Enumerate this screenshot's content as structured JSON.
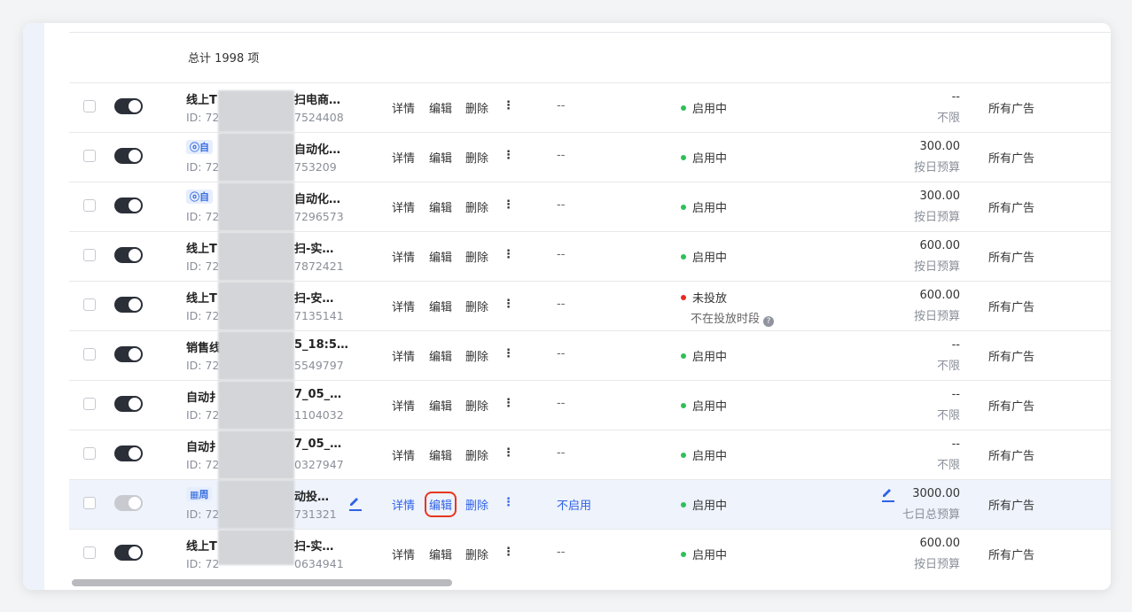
{
  "summary": "总计 1998 项",
  "actions": {
    "detail": "详情",
    "edit": "编辑",
    "delete": "删除",
    "more": "⋮"
  },
  "rows": [
    {
      "name_start": "线上T",
      "name_end": "扫电商…",
      "tag": "",
      "id_prefix": "ID: 72",
      "id_suffix": "7524408",
      "col": "--",
      "status": "启用中",
      "status_color": "#2fbf5a",
      "substatus": "",
      "budget_value": "--",
      "budget_type": "不限",
      "scope": "所有广告",
      "toggle_on": true
    },
    {
      "name_start": "",
      "name_end": "自动化…",
      "tag": "ⓞ自",
      "id_prefix": "ID: 72",
      "id_suffix": "753209",
      "col": "--",
      "status": "启用中",
      "status_color": "#2fbf5a",
      "substatus": "",
      "budget_value": "300.00",
      "budget_type": "按日预算",
      "scope": "所有广告",
      "toggle_on": true
    },
    {
      "name_start": "",
      "name_end": "自动化…",
      "tag": "ⓞ自",
      "id_prefix": "ID: 72",
      "id_suffix": "7296573",
      "col": "--",
      "status": "启用中",
      "status_color": "#2fbf5a",
      "substatus": "",
      "budget_value": "300.00",
      "budget_type": "按日预算",
      "scope": "所有广告",
      "toggle_on": true
    },
    {
      "name_start": "线上T",
      "name_end": "扫-实…",
      "tag": "",
      "id_prefix": "ID: 72",
      "id_suffix": "7872421",
      "col": "--",
      "status": "启用中",
      "status_color": "#2fbf5a",
      "substatus": "",
      "budget_value": "600.00",
      "budget_type": "按日预算",
      "scope": "所有广告",
      "toggle_on": true
    },
    {
      "name_start": "线上T",
      "name_end": "扫-安…",
      "tag": "",
      "id_prefix": "ID: 72",
      "id_suffix": "7135141",
      "col": "--",
      "status": "未投放",
      "status_color": "#e8291f",
      "substatus": "不在投放时段",
      "budget_value": "600.00",
      "budget_type": "按日预算",
      "scope": "所有广告",
      "toggle_on": true
    },
    {
      "name_start": "销售线",
      "name_end": "5_18:5…",
      "tag": "",
      "id_prefix": "ID: 72",
      "id_suffix": "5549797",
      "col": "--",
      "status": "启用中",
      "status_color": "#2fbf5a",
      "substatus": "",
      "budget_value": "--",
      "budget_type": "不限",
      "scope": "所有广告",
      "toggle_on": true
    },
    {
      "name_start": "自动扌",
      "name_end": "7_05_…",
      "tag": "",
      "id_prefix": "ID: 72",
      "id_suffix": "1104032",
      "col": "--",
      "status": "启用中",
      "status_color": "#2fbf5a",
      "substatus": "",
      "budget_value": "--",
      "budget_type": "不限",
      "scope": "所有广告",
      "toggle_on": true
    },
    {
      "name_start": "自动扌",
      "name_end": "7_05_…",
      "tag": "",
      "id_prefix": "ID: 72",
      "id_suffix": "0327947",
      "col": "--",
      "status": "启用中",
      "status_color": "#2fbf5a",
      "substatus": "",
      "budget_value": "--",
      "budget_type": "不限",
      "scope": "所有广告",
      "toggle_on": true
    },
    {
      "name_start": "",
      "name_end": "动投…",
      "tag": "▦周",
      "id_prefix": "ID: 72",
      "id_suffix": "731321",
      "col": "不启用",
      "status": "启用中",
      "status_color": "#2fbf5a",
      "substatus": "",
      "budget_value": "3000.00",
      "budget_type": "七日总预算",
      "scope": "所有广告",
      "toggle_on": false,
      "selected": true
    },
    {
      "name_start": "线上T",
      "name_end": "扫-实…",
      "tag": "",
      "id_prefix": "ID: 72",
      "id_suffix": "0634941",
      "col": "--",
      "status": "启用中",
      "status_color": "#2fbf5a",
      "substatus": "",
      "budget_value": "600.00",
      "budget_type": "按日预算",
      "scope": "所有广告",
      "toggle_on": true
    }
  ],
  "icons": {
    "pencil": "pencil-icon",
    "help": "help-circle-icon",
    "more": "more-vertical-icon"
  }
}
